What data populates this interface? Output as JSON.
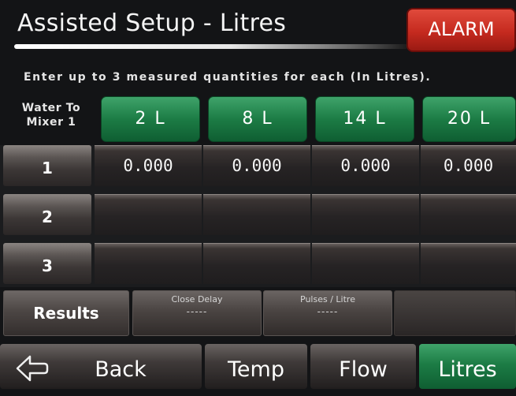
{
  "header": {
    "title": "Assisted Setup - Litres",
    "alarm_label": "ALARM"
  },
  "instruction": "Enter up to 3 measured quantities for each (In Litres).",
  "row_header": {
    "line1": "Water To",
    "line2": "Mixer 1"
  },
  "quantities": [
    "2 L",
    "8 L",
    "14 L",
    "20 L"
  ],
  "rows": [
    {
      "label": "1",
      "values": [
        "0.000",
        "0.000",
        "0.000",
        "0.000"
      ]
    },
    {
      "label": "2",
      "values": [
        "",
        "",
        "",
        ""
      ]
    },
    {
      "label": "3",
      "values": [
        "",
        "",
        "",
        ""
      ]
    }
  ],
  "results": {
    "label": "Results",
    "close_delay": {
      "label": "Close Delay",
      "value": "-----"
    },
    "pulses_per_litre": {
      "label": "Pulses / Litre",
      "value": "-----"
    }
  },
  "nav": {
    "back_label": "Back",
    "temp_label": "Temp",
    "flow_label": "Flow",
    "litres_label": "Litres",
    "active": "litres"
  },
  "colors": {
    "accent_green": "#1c7c45",
    "alarm_red": "#c52a1f",
    "background": "#131416"
  },
  "icons": {
    "back": "back-arrow-icon"
  }
}
